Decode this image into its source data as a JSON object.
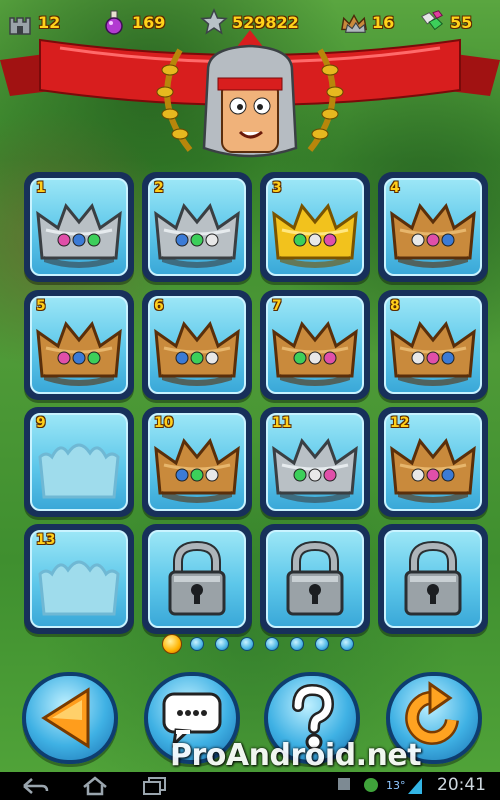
{
  "stats": {
    "castles": "12",
    "potions": "169",
    "stars": "529822",
    "crowns": "16",
    "gems": "55"
  },
  "grid": {
    "tiles": [
      {
        "number": "1",
        "state": "crown",
        "crown": "silver"
      },
      {
        "number": "2",
        "state": "crown",
        "crown": "silver"
      },
      {
        "number": "3",
        "state": "crown",
        "crown": "gold"
      },
      {
        "number": "4",
        "state": "crown",
        "crown": "bronze"
      },
      {
        "number": "5",
        "state": "crown",
        "crown": "bronze"
      },
      {
        "number": "6",
        "state": "crown",
        "crown": "bronze"
      },
      {
        "number": "7",
        "state": "crown",
        "crown": "bronze"
      },
      {
        "number": "8",
        "state": "crown",
        "crown": "bronze"
      },
      {
        "number": "9",
        "state": "empty",
        "crown": "outline"
      },
      {
        "number": "10",
        "state": "crown",
        "crown": "bronze"
      },
      {
        "number": "11",
        "state": "crown",
        "crown": "silver"
      },
      {
        "number": "12",
        "state": "crown",
        "crown": "bronze"
      },
      {
        "number": "13",
        "state": "empty",
        "crown": "outline"
      },
      {
        "number": "",
        "state": "locked",
        "crown": "lock"
      },
      {
        "number": "",
        "state": "locked",
        "crown": "lock"
      },
      {
        "number": "",
        "state": "locked",
        "crown": "lock"
      }
    ]
  },
  "pager": {
    "pages": 8,
    "current": 1
  },
  "buttons": {
    "back": "back-arrow-icon",
    "chat": "speech-bubble-icon",
    "help": "question-icon",
    "replay": "replay-arrow-icon"
  },
  "watermark": "ProAndroid.net",
  "statusbar": {
    "temperature": "13°",
    "time": "20:41"
  },
  "colors": {
    "banner": "#d81e1e",
    "tile_frame": "#17305a",
    "tile_fill": "#5dc7ea",
    "number": "#ffcf1a"
  }
}
